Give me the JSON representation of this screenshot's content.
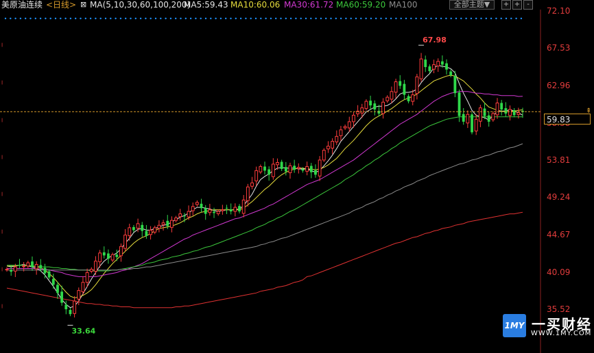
{
  "header": {
    "title": "美原油连续",
    "period": "<日线>",
    "ma_label": "MA(5,10,30,60,100,200)",
    "ma5": "MA5:59.43",
    "ma10": "MA10:60.06",
    "ma30": "MA30:61.72",
    "ma60": "MA60:59.20",
    "ma100": "MA100",
    "theme_button": "全部主题▼",
    "btn1": "+",
    "btn2": "+",
    "btn3": "-"
  },
  "yaxis": {
    "ticks": [
      "72.10",
      "67.53",
      "62.96",
      "58.38",
      "53.81",
      "49.24",
      "44.67",
      "40.09",
      "35.52"
    ],
    "current_price": "59.83"
  },
  "annotations": {
    "high": "67.98",
    "low": "33.64"
  },
  "watermark": {
    "name": "一买财经",
    "url": "WWW.1MY.COM",
    "logo": "1MY"
  },
  "colors": {
    "up": "#ff3c3c",
    "down": "#2fd84a",
    "ma5": "#e6e6e6",
    "ma10": "#e6dc3c",
    "ma30": "#d239d2",
    "ma60": "#3cc83c",
    "ma100": "#8c8c8c",
    "ma200": "#e03232",
    "dotted": "#1e90ff"
  },
  "chart_data": {
    "type": "candlestick",
    "ylim": [
      35.52,
      72.1
    ],
    "y_ticks": [
      72.1,
      67.53,
      62.96,
      58.38,
      53.81,
      49.24,
      44.67,
      40.09,
      35.52
    ],
    "current_price": 59.83,
    "high": 67.98,
    "low": 33.64,
    "closes": [
      40.5,
      40.2,
      40.8,
      41.0,
      40.9,
      41.3,
      40.8,
      41.1,
      40.6,
      40.0,
      39.5,
      38.6,
      37.6,
      36.4,
      35.6,
      35.0,
      36.6,
      37.9,
      38.9,
      40.1,
      40.5,
      41.5,
      42.5,
      42.2,
      41.8,
      42.3,
      42.0,
      43.3,
      44.7,
      45.6,
      45.3,
      46.1,
      45.2,
      44.6,
      45.3,
      45.6,
      45.9,
      46.2,
      45.8,
      46.5,
      46.8,
      47.3,
      47.0,
      47.6,
      48.2,
      48.7,
      48.0,
      47.3,
      47.8,
      47.4,
      47.6,
      47.8,
      48.0,
      47.6,
      48.1,
      47.6,
      49.0,
      50.6,
      51.1,
      52.6,
      53.1,
      52.6,
      52.1,
      53.4,
      53.6,
      52.8,
      52.5,
      53.2,
      52.7,
      53.0,
      52.6,
      53.1,
      52.4,
      52.1,
      53.9,
      55.1,
      55.6,
      56.2,
      56.8,
      57.6,
      58.0,
      58.6,
      59.4,
      59.9,
      60.3,
      61.1,
      60.6,
      60.1,
      59.6,
      61.0,
      61.6,
      62.3,
      63.5,
      63.0,
      61.9,
      61.1,
      61.9,
      64.1,
      66.3,
      65.3,
      64.8,
      65.6,
      66.0,
      65.6,
      65.0,
      64.3,
      62.1,
      59.3,
      58.6,
      59.5,
      57.3,
      58.9,
      60.3,
      59.3,
      58.6,
      59.6,
      60.9,
      60.1,
      59.6,
      60.1,
      59.4,
      59.7,
      59.8
    ],
    "ma_series": [
      {
        "name": "MA5",
        "values": [
          40.9,
          40.8,
          40.9,
          41.0,
          41.1,
          40.9,
          40.8,
          40.6,
          40.3,
          39.8,
          39.1,
          38.4,
          37.6,
          36.8,
          36.2,
          35.8,
          36.0,
          36.6,
          37.5,
          38.4,
          39.3,
          40.1,
          40.9,
          41.5,
          41.9,
          42.2,
          42.5,
          43.0,
          43.7,
          44.3,
          45.0,
          45.4,
          45.5,
          45.3,
          45.3,
          45.5,
          45.7,
          45.9,
          46.0,
          46.3,
          46.6,
          46.9,
          47.1,
          47.4,
          47.8,
          48.1,
          48.1,
          48.0,
          47.9,
          47.7,
          47.6,
          47.7,
          47.8,
          47.8,
          47.8,
          47.9,
          48.3,
          49.0,
          49.7,
          50.7,
          51.5,
          51.9,
          52.2,
          52.6,
          52.9,
          53.0,
          52.9,
          52.9,
          52.9,
          52.8,
          52.8,
          52.8,
          52.6,
          52.4,
          52.6,
          53.2,
          53.8,
          54.5,
          55.3,
          56.2,
          56.8,
          57.4,
          58.0,
          58.6,
          59.2,
          59.8,
          60.1,
          60.4,
          60.5,
          60.5,
          60.6,
          60.9,
          61.4,
          62.0,
          62.2,
          62.2,
          62.3,
          62.6,
          63.4,
          64.0,
          64.5,
          65.2,
          65.5,
          65.4,
          65.3,
          65.1,
          64.6,
          63.3,
          62.1,
          61.1,
          60.0,
          59.4,
          59.2,
          59.1,
          58.8,
          59.4,
          59.8,
          59.9,
          59.9,
          60.1,
          59.9,
          59.7,
          59.4
        ]
      },
      {
        "name": "MA10",
        "values": [
          40.9,
          40.9,
          40.9,
          41.0,
          41.0,
          41.0,
          40.9,
          40.8,
          40.7,
          40.4,
          40.0,
          39.5,
          38.9,
          38.3,
          37.7,
          37.2,
          37.0,
          37.1,
          37.3,
          37.6,
          38.0,
          38.6,
          39.3,
          40.0,
          40.6,
          41.2,
          41.7,
          42.2,
          42.7,
          43.2,
          43.7,
          44.1,
          44.4,
          44.6,
          44.9,
          45.2,
          45.5,
          45.6,
          45.7,
          45.8,
          46.0,
          46.2,
          46.5,
          46.8,
          47.0,
          47.3,
          47.5,
          47.6,
          47.7,
          47.8,
          47.8,
          47.8,
          47.8,
          47.8,
          47.8,
          47.8,
          48.0,
          48.4,
          48.8,
          49.3,
          49.8,
          50.3,
          50.7,
          51.2,
          51.7,
          52.1,
          52.4,
          52.6,
          52.8,
          52.9,
          52.9,
          52.8,
          52.8,
          52.7,
          52.8,
          53.0,
          53.3,
          53.7,
          54.1,
          54.7,
          55.3,
          55.8,
          56.3,
          56.9,
          57.5,
          58.1,
          58.6,
          59.0,
          59.3,
          59.6,
          59.9,
          60.2,
          60.6,
          61.0,
          61.3,
          61.5,
          61.7,
          62.0,
          62.4,
          62.8,
          63.2,
          63.6,
          63.8,
          64.0,
          64.2,
          64.3,
          64.2,
          63.9,
          63.6,
          63.1,
          62.6,
          62.0,
          61.5,
          60.9,
          60.4,
          60.2,
          60.0,
          59.9,
          59.8,
          59.9,
          59.9,
          60.0,
          60.06
        ]
      },
      {
        "name": "MA30",
        "values": [
          40.6,
          40.6,
          40.6,
          40.6,
          40.6,
          40.6,
          40.6,
          40.6,
          40.5,
          40.5,
          40.4,
          40.3,
          40.2,
          40.1,
          39.9,
          39.8,
          39.7,
          39.6,
          39.6,
          39.6,
          39.6,
          39.6,
          39.7,
          39.8,
          39.9,
          40.0,
          40.1,
          40.3,
          40.4,
          40.6,
          40.8,
          41.0,
          41.2,
          41.5,
          41.8,
          42.1,
          42.4,
          42.7,
          43.0,
          43.3,
          43.6,
          43.9,
          44.2,
          44.4,
          44.7,
          44.9,
          45.1,
          45.3,
          45.5,
          45.7,
          45.9,
          46.1,
          46.3,
          46.5,
          46.7,
          46.8,
          47.0,
          47.2,
          47.4,
          47.6,
          47.8,
          48.0,
          48.3,
          48.5,
          48.8,
          49.1,
          49.4,
          49.7,
          50.0,
          50.3,
          50.6,
          50.9,
          51.1,
          51.3,
          51.5,
          51.8,
          52.1,
          52.4,
          52.7,
          53.0,
          53.3,
          53.6,
          53.9,
          54.3,
          54.7,
          55.1,
          55.5,
          55.9,
          56.3,
          56.7,
          57.1,
          57.5,
          57.9,
          58.3,
          58.6,
          58.9,
          59.2,
          59.5,
          59.9,
          60.3,
          60.7,
          61.1,
          61.4,
          61.7,
          61.9,
          62.1,
          62.2,
          62.3,
          62.3,
          62.3,
          62.2,
          62.1,
          62.1,
          62.0,
          62.0,
          61.9,
          61.9,
          61.8,
          61.8,
          61.8,
          61.8,
          61.7,
          61.72
        ]
      },
      {
        "name": "MA60",
        "values": [
          41.0,
          41.0,
          41.0,
          41.0,
          41.0,
          40.9,
          40.9,
          40.9,
          40.8,
          40.8,
          40.8,
          40.7,
          40.7,
          40.6,
          40.6,
          40.5,
          40.5,
          40.4,
          40.4,
          40.4,
          40.3,
          40.3,
          40.3,
          40.3,
          40.3,
          40.4,
          40.4,
          40.5,
          40.6,
          40.7,
          40.8,
          40.9,
          41.0,
          41.2,
          41.3,
          41.4,
          41.6,
          41.7,
          41.8,
          42.0,
          42.1,
          42.2,
          42.4,
          42.5,
          42.7,
          42.8,
          43.0,
          43.2,
          43.3,
          43.5,
          43.7,
          43.9,
          44.1,
          44.3,
          44.5,
          44.7,
          44.9,
          45.1,
          45.3,
          45.6,
          45.8,
          46.0,
          46.3,
          46.5,
          46.8,
          47.0,
          47.3,
          47.6,
          47.8,
          48.1,
          48.4,
          48.7,
          49.0,
          49.3,
          49.6,
          49.9,
          50.2,
          50.5,
          50.8,
          51.1,
          51.5,
          51.8,
          52.1,
          52.5,
          52.8,
          53.2,
          53.5,
          53.9,
          54.2,
          54.6,
          54.9,
          55.3,
          55.6,
          56.0,
          56.3,
          56.6,
          56.9,
          57.2,
          57.5,
          57.8,
          58.1,
          58.3,
          58.5,
          58.7,
          58.9,
          59.0,
          59.1,
          59.2,
          59.2,
          59.2,
          59.2,
          59.2,
          59.2,
          59.2,
          59.2,
          59.2,
          59.2,
          59.2,
          59.2,
          59.2,
          59.2,
          59.2,
          59.2
        ]
      },
      {
        "name": "MA100",
        "values": [
          40.4,
          40.4,
          40.4,
          40.4,
          40.4,
          40.4,
          40.4,
          40.4,
          40.4,
          40.4,
          40.4,
          40.4,
          40.4,
          40.4,
          40.4,
          40.4,
          40.4,
          40.4,
          40.4,
          40.4,
          40.4,
          40.4,
          40.4,
          40.4,
          40.4,
          40.4,
          40.4,
          40.5,
          40.5,
          40.5,
          40.6,
          40.6,
          40.7,
          40.8,
          40.8,
          40.9,
          41.0,
          41.1,
          41.2,
          41.3,
          41.4,
          41.5,
          41.6,
          41.7,
          41.8,
          41.9,
          42.0,
          42.1,
          42.2,
          42.3,
          42.4,
          42.5,
          42.6,
          42.7,
          42.8,
          42.9,
          43.0,
          43.1,
          43.2,
          43.3,
          43.5,
          43.6,
          43.8,
          43.9,
          44.1,
          44.3,
          44.4,
          44.6,
          44.8,
          45.0,
          45.2,
          45.4,
          45.6,
          45.8,
          46.0,
          46.2,
          46.4,
          46.6,
          46.8,
          47.0,
          47.2,
          47.4,
          47.7,
          47.9,
          48.1,
          48.4,
          48.6,
          48.8,
          49.1,
          49.3,
          49.6,
          49.8,
          50.1,
          50.3,
          50.6,
          50.8,
          51.0,
          51.3,
          51.5,
          51.7,
          52.0,
          52.2,
          52.4,
          52.6,
          52.8,
          53.0,
          53.2,
          53.4,
          53.5,
          53.7,
          53.9,
          54.0,
          54.2,
          54.4,
          54.5,
          54.7,
          54.9,
          55.0,
          55.2,
          55.4,
          55.5,
          55.7,
          55.9
        ]
      },
      {
        "name": "MA200",
        "values": [
          38.2,
          38.1,
          38.0,
          37.9,
          37.8,
          37.7,
          37.6,
          37.5,
          37.4,
          37.3,
          37.2,
          37.1,
          37.0,
          36.9,
          36.8,
          36.7,
          36.6,
          36.5,
          36.4,
          36.3,
          36.3,
          36.2,
          36.2,
          36.1,
          36.1,
          36.0,
          36.0,
          35.9,
          35.9,
          35.9,
          35.8,
          35.8,
          35.8,
          35.8,
          35.8,
          35.8,
          35.8,
          35.8,
          35.8,
          35.8,
          35.9,
          35.9,
          36.0,
          36.0,
          36.1,
          36.2,
          36.3,
          36.4,
          36.5,
          36.6,
          36.7,
          36.8,
          36.9,
          37.0,
          37.1,
          37.2,
          37.3,
          37.4,
          37.5,
          37.6,
          37.8,
          37.9,
          38.0,
          38.1,
          38.3,
          38.4,
          38.5,
          38.7,
          38.9,
          39.0,
          39.2,
          39.6,
          39.7,
          39.9,
          40.1,
          40.3,
          40.5,
          40.7,
          40.9,
          41.1,
          41.3,
          41.5,
          41.7,
          41.9,
          42.1,
          42.3,
          42.5,
          42.7,
          42.9,
          43.1,
          43.3,
          43.5,
          43.7,
          43.8,
          44.0,
          44.2,
          44.4,
          44.5,
          44.7,
          44.9,
          45.0,
          45.2,
          45.3,
          45.5,
          45.6,
          45.7,
          45.9,
          46.0,
          46.1,
          46.3,
          46.4,
          46.5,
          46.6,
          46.7,
          46.8,
          46.9,
          47.0,
          47.1,
          47.2,
          47.3,
          47.3,
          47.4,
          47.5
        ]
      }
    ]
  }
}
